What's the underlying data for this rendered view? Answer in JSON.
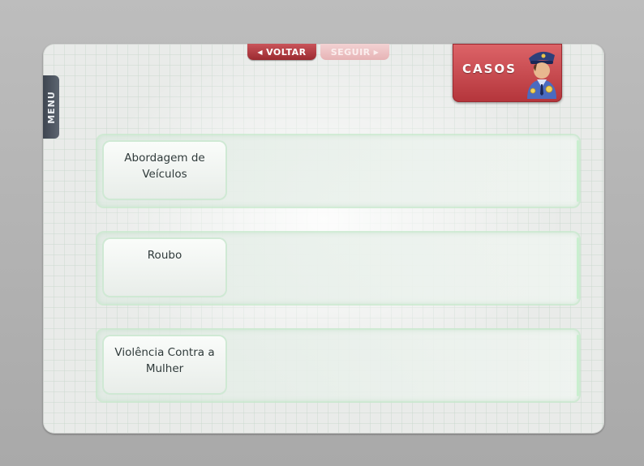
{
  "nav": {
    "menu_label": "MENU",
    "back_label": "VOLTAR",
    "forward_label": "SEGUIR"
  },
  "header": {
    "casos_label": "CASOS",
    "casos_icon": "police-officer-icon"
  },
  "cases": [
    {
      "label": "Abordagem de Veículos"
    },
    {
      "label": "Roubo"
    },
    {
      "label": "Violência Contra a Mulher"
    }
  ],
  "colors": {
    "accent_red": "#b4353b",
    "menu_tab": "#4a525c",
    "card_border": "#cfe9d4"
  }
}
